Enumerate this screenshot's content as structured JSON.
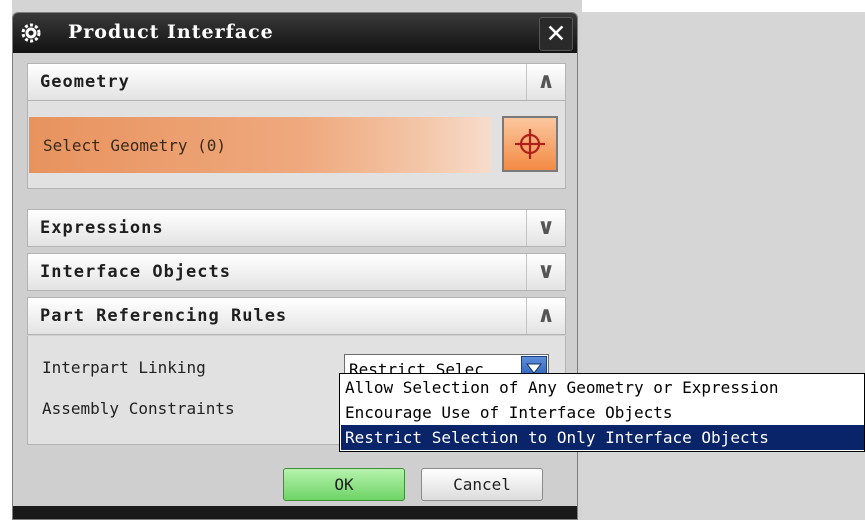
{
  "dialog": {
    "title": "Product Interface",
    "close_label": "✕",
    "icons": {
      "title": "gear-icon",
      "close": "close-icon",
      "select": "crosshair-icon"
    }
  },
  "groups": [
    {
      "label": "Geometry",
      "toggle": "∧",
      "expanded": true
    },
    {
      "label": "Expressions",
      "toggle": "∨",
      "expanded": false
    },
    {
      "label": "Interface Objects",
      "toggle": "∨",
      "expanded": false
    },
    {
      "label": "Part Referencing Rules",
      "toggle": "∧",
      "expanded": true
    }
  ],
  "geometry": {
    "select_label": "Select Geometry (0)"
  },
  "rules": {
    "interpart_linking_label": "Interpart Linking",
    "interpart_linking_value": "Restrict Selec",
    "assembly_constraints_label": "Assembly Constraints"
  },
  "dropdown": {
    "options": [
      "Allow Selection of Any Geometry or Expression",
      "Encourage Use of Interface Objects",
      "Restrict Selection to Only Interface Objects"
    ],
    "selected_index": 2
  },
  "buttons": {
    "ok": "OK",
    "cancel": "Cancel"
  },
  "colors": {
    "titlebar": "#1a1a1a",
    "selection_bar": "#e8935e",
    "ok_button": "#6ed465",
    "dropdown_highlight": "#0a246a"
  }
}
